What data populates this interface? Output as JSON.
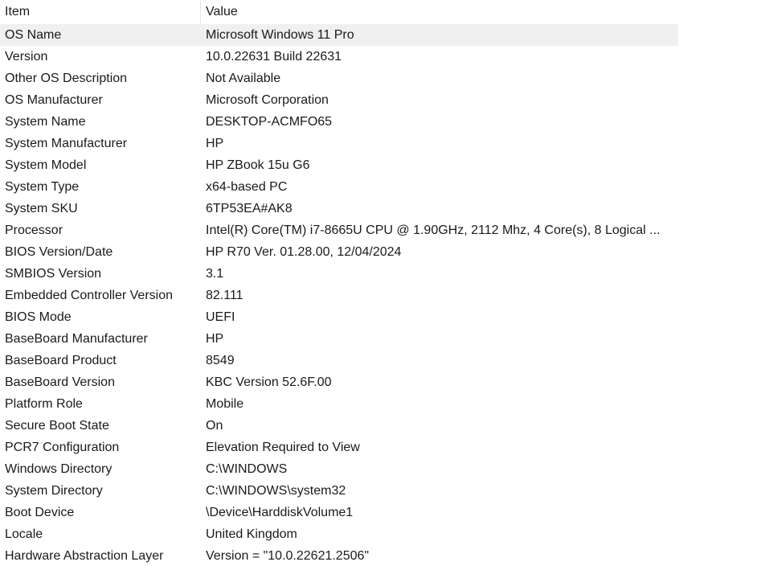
{
  "header": {
    "item_label": "Item",
    "value_label": "Value"
  },
  "rows": [
    {
      "item": "OS Name",
      "value": "Microsoft Windows 11 Pro"
    },
    {
      "item": "Version",
      "value": "10.0.22631 Build 22631"
    },
    {
      "item": "Other OS Description",
      "value": "Not Available"
    },
    {
      "item": "OS Manufacturer",
      "value": "Microsoft Corporation"
    },
    {
      "item": "System Name",
      "value": "DESKTOP-ACMFO65"
    },
    {
      "item": "System Manufacturer",
      "value": "HP"
    },
    {
      "item": "System Model",
      "value": "HP ZBook 15u G6"
    },
    {
      "item": "System Type",
      "value": "x64-based PC"
    },
    {
      "item": "System SKU",
      "value": "6TP53EA#AK8"
    },
    {
      "item": "Processor",
      "value": "Intel(R) Core(TM) i7-8665U CPU @ 1.90GHz, 2112 Mhz, 4 Core(s), 8 Logical ..."
    },
    {
      "item": "BIOS Version/Date",
      "value": "HP R70 Ver. 01.28.00, 12/04/2024"
    },
    {
      "item": "SMBIOS Version",
      "value": "3.1"
    },
    {
      "item": "Embedded Controller Version",
      "value": "82.111"
    },
    {
      "item": "BIOS Mode",
      "value": "UEFI"
    },
    {
      "item": "BaseBoard Manufacturer",
      "value": "HP"
    },
    {
      "item": "BaseBoard Product",
      "value": "8549"
    },
    {
      "item": "BaseBoard Version",
      "value": "KBC Version 52.6F.00"
    },
    {
      "item": "Platform Role",
      "value": "Mobile"
    },
    {
      "item": "Secure Boot State",
      "value": "On"
    },
    {
      "item": "PCR7 Configuration",
      "value": "Elevation Required to View"
    },
    {
      "item": "Windows Directory",
      "value": "C:\\WINDOWS"
    },
    {
      "item": "System Directory",
      "value": "C:\\WINDOWS\\system32"
    },
    {
      "item": "Boot Device",
      "value": "\\Device\\HarddiskVolume1"
    },
    {
      "item": "Locale",
      "value": "United Kingdom"
    },
    {
      "item": "Hardware Abstraction Layer",
      "value": "Version = \"10.0.22621.2506\""
    }
  ]
}
